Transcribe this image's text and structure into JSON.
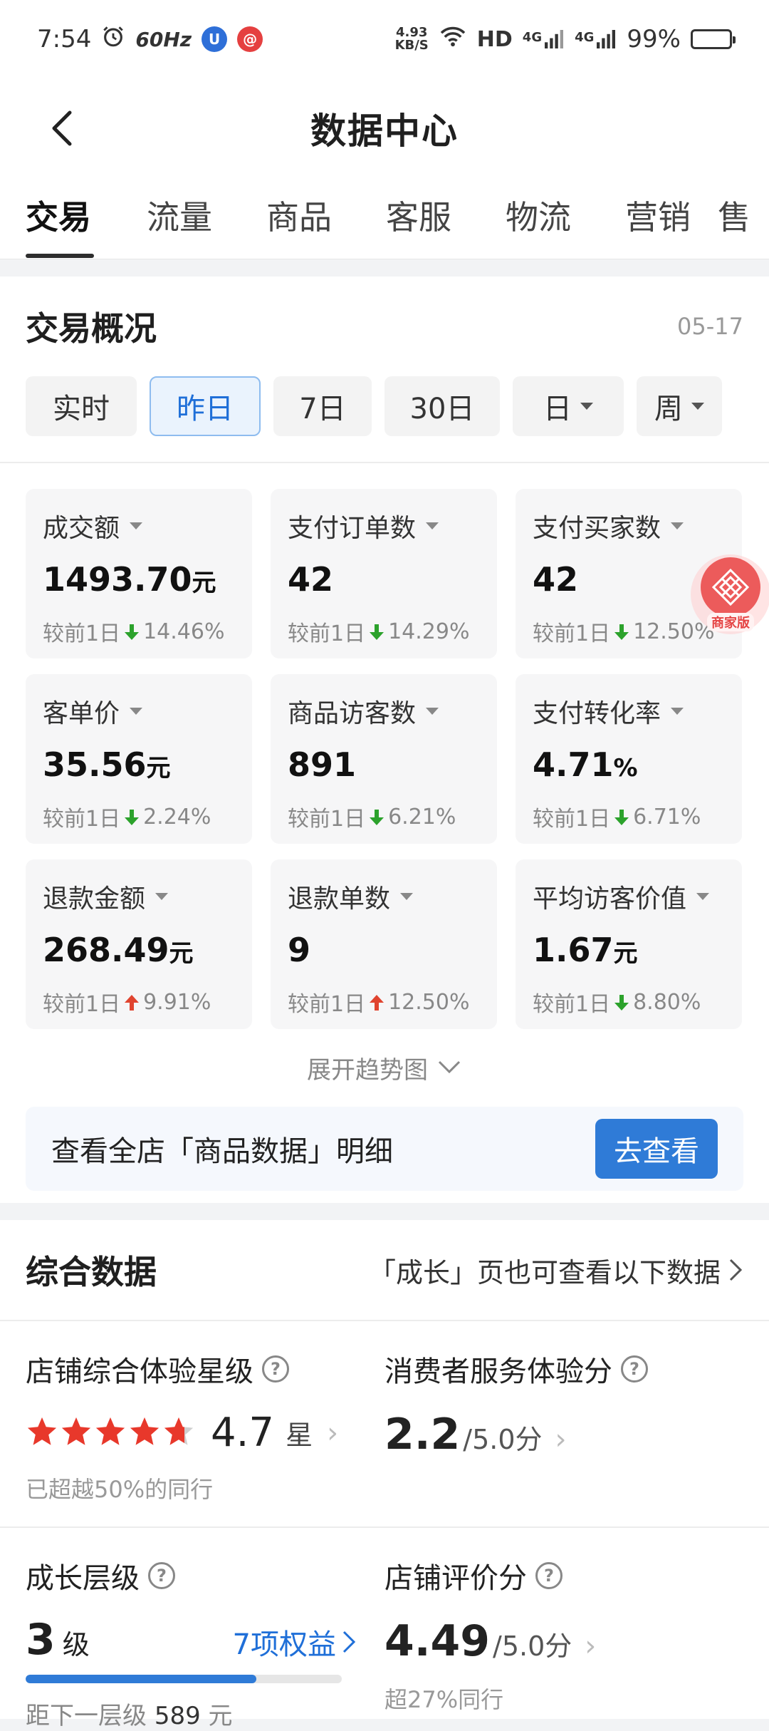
{
  "status_bar": {
    "time": "7:54",
    "refresh": "60Hz",
    "net_speed_top": "4.93",
    "net_speed_bottom": "KB/S",
    "network": "HD",
    "sig1": "4G",
    "sig2": "4G",
    "battery": "99%"
  },
  "nav": {
    "title": "数据中心"
  },
  "tabs": [
    "交易",
    "流量",
    "商品",
    "客服",
    "物流",
    "营销",
    "售"
  ],
  "overview": {
    "title": "交易概况",
    "date": "05-17",
    "chips": [
      {
        "label": "实时"
      },
      {
        "label": "昨日"
      },
      {
        "label": "7日"
      },
      {
        "label": "30日"
      },
      {
        "label": "日"
      },
      {
        "label": "周"
      }
    ],
    "metrics": [
      {
        "label": "成交额",
        "value": "1493.70",
        "unit": "元",
        "compare": "较前1日",
        "pct": "14.46%",
        "dir": "down"
      },
      {
        "label": "支付订单数",
        "value": "42",
        "unit": "",
        "compare": "较前1日",
        "pct": "14.29%",
        "dir": "down"
      },
      {
        "label": "支付买家数",
        "value": "42",
        "unit": "",
        "compare": "较前1日",
        "pct": "12.50%",
        "dir": "down"
      },
      {
        "label": "客单价",
        "value": "35.56",
        "unit": "元",
        "compare": "较前1日",
        "pct": "2.24%",
        "dir": "down"
      },
      {
        "label": "商品访客数",
        "value": "891",
        "unit": "",
        "compare": "较前1日",
        "pct": "6.21%",
        "dir": "down"
      },
      {
        "label": "支付转化率",
        "value": "4.71",
        "unit": "%",
        "compare": "较前1日",
        "pct": "6.71%",
        "dir": "down"
      },
      {
        "label": "退款金额",
        "value": "268.49",
        "unit": "元",
        "compare": "较前1日",
        "pct": "9.91%",
        "dir": "up"
      },
      {
        "label": "退款单数",
        "value": "9",
        "unit": "",
        "compare": "较前1日",
        "pct": "12.50%",
        "dir": "up"
      },
      {
        "label": "平均访客价值",
        "value": "1.67",
        "unit": "元",
        "compare": "较前1日",
        "pct": "8.80%",
        "dir": "down"
      }
    ],
    "float_badge_tag": "商家版",
    "expand_label": "展开趋势图",
    "cta_text": "查看全店「商品数据」明细",
    "cta_button": "去查看"
  },
  "summary": {
    "title": "综合数据",
    "link": "「成长」页也可查看以下数据",
    "store_experience": {
      "title": "店铺综合体验星级",
      "rating": 4.7,
      "score": "4.7",
      "unit": "星",
      "note": "已超越50%的同行"
    },
    "consumer_service": {
      "title": "消费者服务体验分",
      "score": "2.2",
      "suffix": "/5.0分"
    },
    "growth": {
      "title": "成长层级",
      "level": "3",
      "level_unit": "级",
      "benefit": "7项权益",
      "progress": 0.73,
      "dist_label": "距下一层级",
      "dist_value": "589",
      "dist_unit": "元"
    },
    "review_score": {
      "title": "店铺评价分",
      "score": "4.49",
      "suffix": "/5.0分",
      "note": "超27%同行"
    }
  },
  "colors": {
    "accent": "#2f7bd7",
    "down": "#2ca22c",
    "up": "#e0442f",
    "star": "#e8382b"
  }
}
